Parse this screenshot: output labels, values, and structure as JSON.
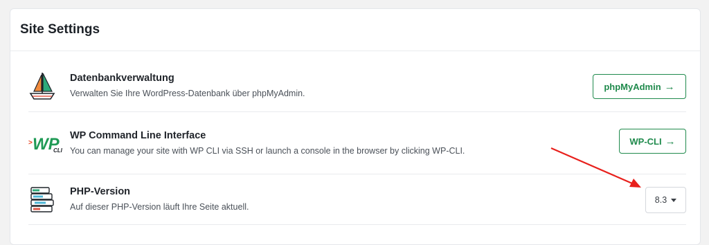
{
  "card": {
    "title": "Site Settings"
  },
  "rows": [
    {
      "title": "Datenbankverwaltung",
      "description": "Verwalten Sie Ihre WordPress-Datenbank über phpMyAdmin.",
      "icon": "sailboat-icon",
      "button_label": "phpMyAdmin",
      "button_arrow": "→"
    },
    {
      "title": "WP Command Line Interface",
      "description": "You can manage your site with WP CLI via SSH or launch a console in the browser by clicking WP-CLI.",
      "icon": "wp-cli-logo-icon",
      "logo_text": "WP",
      "logo_sub": "CLI",
      "logo_prompt": ">",
      "button_label": "WP-CLI",
      "button_arrow": "→"
    },
    {
      "title": "PHP-Version",
      "description": "Auf dieser PHP-Version läuft Ihre Seite aktuell.",
      "icon": "server-stack-icon",
      "select_value": "8.3"
    }
  ],
  "colors": {
    "accent_green": "#1f8a4c",
    "annotation_red": "#e8201c"
  }
}
